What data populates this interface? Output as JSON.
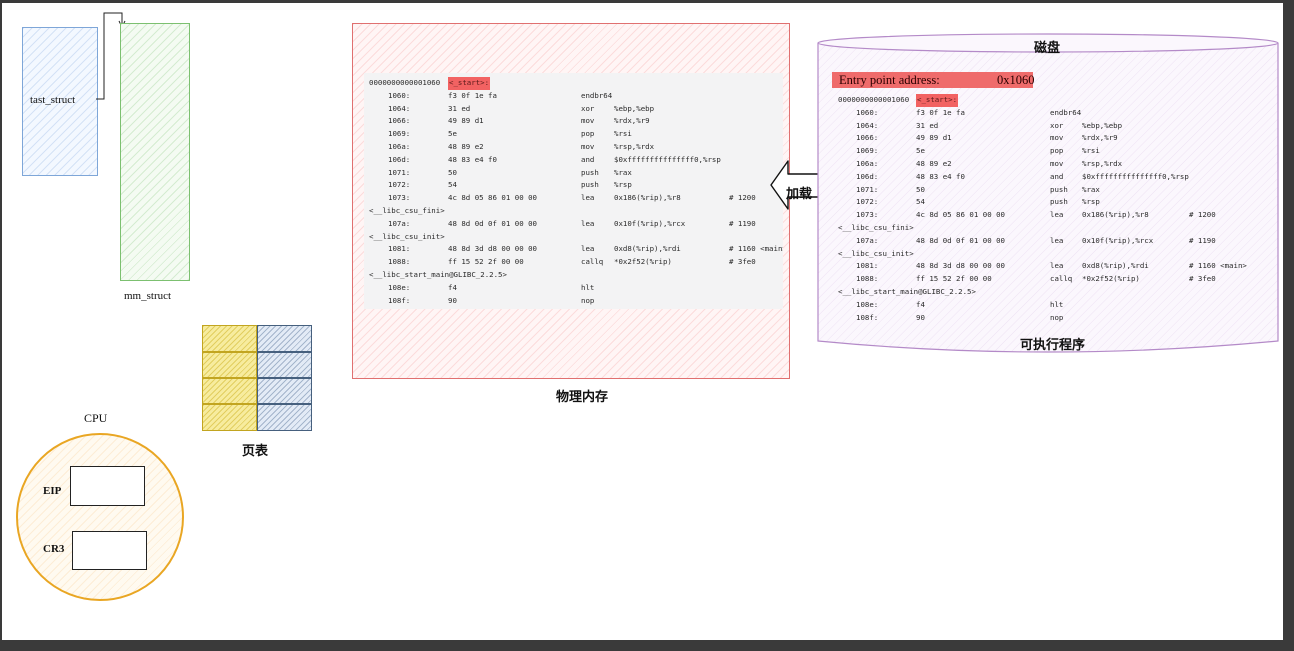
{
  "labels": {
    "tast_struct": "tast_struct",
    "mm_struct": "mm_struct",
    "page_table": "页表",
    "cpu": "CPU",
    "eip": "EIP",
    "cr3": "CR3",
    "physical_memory": "物理内存",
    "disk": "磁盘",
    "executable": "可执行程序",
    "load": "加载"
  },
  "entry_point": {
    "label": "Entry point address:",
    "value": "0x1060"
  },
  "disassembly": {
    "header_addr": "0000000000001060",
    "header_symbol": "<_start>:",
    "lines": [
      {
        "addr": "1060:",
        "bytes": "f3 0f 1e fa",
        "op": "endbr64",
        "args": ""
      },
      {
        "addr": "1064:",
        "bytes": "31 ed",
        "op": "xor",
        "args": "%ebp,%ebp"
      },
      {
        "addr": "1066:",
        "bytes": "49 89 d1",
        "op": "mov",
        "args": "%rdx,%r9"
      },
      {
        "addr": "1069:",
        "bytes": "5e",
        "op": "pop",
        "args": "%rsi"
      },
      {
        "addr": "106a:",
        "bytes": "48 89 e2",
        "op": "mov",
        "args": "%rsp,%rdx"
      },
      {
        "addr": "106d:",
        "bytes": "48 83 e4 f0",
        "op": "and",
        "args": "$0xfffffffffffffff0,%rsp"
      },
      {
        "addr": "1071:",
        "bytes": "50",
        "op": "push",
        "args": "%rax"
      },
      {
        "addr": "1072:",
        "bytes": "54",
        "op": "push",
        "args": "%rsp"
      },
      {
        "addr": "1073:",
        "bytes": "4c 8d 05 86 01 00 00",
        "op": "lea",
        "args": "0x186(%rip),%r8",
        "comment": "# 1200",
        "cont": "<__libc_csu_fini>"
      },
      {
        "addr": "107a:",
        "bytes": "48 8d 0d 0f 01 00 00",
        "op": "lea",
        "args": "0x10f(%rip),%rcx",
        "comment": "# 1190",
        "cont": "<__libc_csu_init>"
      },
      {
        "addr": "1081:",
        "bytes": "48 8d 3d d8 00 00 00",
        "op": "lea",
        "args": "0xd8(%rip),%rdi",
        "comment": "# 1160 <main>"
      },
      {
        "addr": "1088:",
        "bytes": "ff 15 52 2f 00 00",
        "op": "callq",
        "args": "*0x2f52(%rip)",
        "comment": "# 3fe0",
        "cont": "<__libc_start_main@GLIBC_2.2.5>"
      },
      {
        "addr": "108e:",
        "bytes": "f4",
        "op": "hlt",
        "args": ""
      },
      {
        "addr": "108f:",
        "bytes": "90",
        "op": "nop",
        "args": ""
      }
    ]
  }
}
